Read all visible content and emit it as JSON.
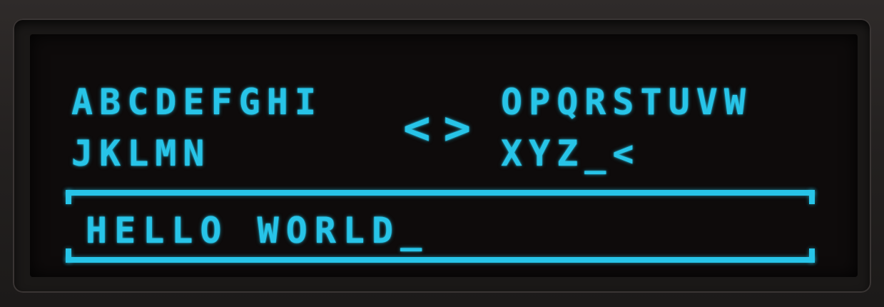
{
  "keyboard": {
    "left_rows": [
      "ABCDEFGHI",
      "JKLMN"
    ],
    "arrows": "<>",
    "right_rows": [
      "OPQRSTUVW",
      "XYZ_<"
    ]
  },
  "input": {
    "value": "HELLO WORLD_"
  },
  "colors": {
    "oled": "#27c4e8",
    "screen": "#0e0b0b",
    "bezel": "#1a1817"
  }
}
